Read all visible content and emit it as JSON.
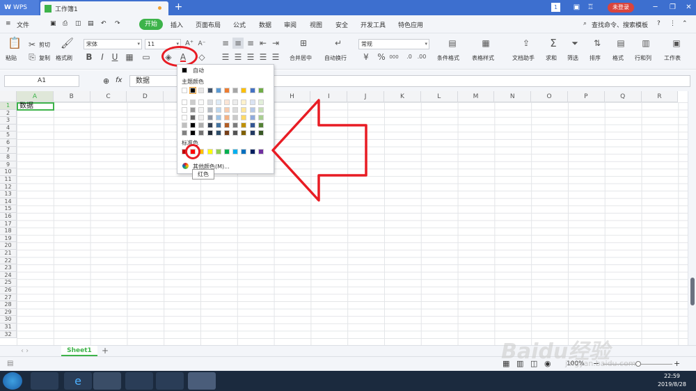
{
  "titlebar": {
    "app": "WPS",
    "doc_tab": "工作簿1",
    "new_tab": "+",
    "page_badge": "1",
    "login": "未登录"
  },
  "menubar": {
    "file": "文件",
    "tabs": [
      "开始",
      "插入",
      "页面布局",
      "公式",
      "数据",
      "审阅",
      "视图",
      "安全",
      "开发工具",
      "特色应用"
    ],
    "search": "查找命令、搜索模板"
  },
  "toolbar": {
    "paste": "粘贴",
    "cut": "剪切",
    "copy": "复制",
    "format_painter": "格式刷",
    "font_name": "宋体",
    "font_size": "11",
    "merge": "合并居中",
    "wrap": "自动换行",
    "number_format": "常规",
    "cond_format": "条件格式",
    "table_style": "表格样式",
    "doc_helper": "文档助手",
    "sum": "求和",
    "filter": "筛选",
    "sort": "排序",
    "format": "格式",
    "rowcol": "行和列",
    "sheet": "工作表",
    "bold": "B",
    "italic": "I",
    "underline": "U",
    "font_color": "A",
    "percent": "%",
    "thousands": "000"
  },
  "formulabar": {
    "cell_ref": "A1",
    "fx": "fx",
    "content": "数据"
  },
  "grid": {
    "columns": [
      "A",
      "B",
      "C",
      "D",
      "E",
      "F",
      "G",
      "H",
      "I",
      "J",
      "K",
      "L",
      "M",
      "N",
      "O",
      "P",
      "Q",
      "R"
    ],
    "rows": [
      "1",
      "2",
      "3",
      "4",
      "5",
      "6",
      "7",
      "8",
      "9",
      "10",
      "11",
      "12",
      "13",
      "14",
      "15",
      "16",
      "17",
      "18",
      "19",
      "20",
      "21",
      "22",
      "23",
      "24",
      "25",
      "26",
      "27",
      "28",
      "29",
      "30",
      "31",
      "32"
    ],
    "a1_value": "数据"
  },
  "palette": {
    "auto_label": "自动",
    "theme_label": "主题颜色",
    "standard_label": "标准色",
    "more_colors": "其他颜色(M)...",
    "tooltip": "红色",
    "theme_top": [
      "#ffffff",
      "#000000",
      "#e7e6e6",
      "#44546a",
      "#5b9bd5",
      "#ed7d31",
      "#a5a5a5",
      "#ffc000",
      "#4472c4",
      "#70ad47"
    ],
    "standard": [
      "#c00000",
      "#ff0000",
      "#ffc000",
      "#ffff00",
      "#92d050",
      "#00b050",
      "#00b0f0",
      "#0070c0",
      "#002060",
      "#7030a0"
    ]
  },
  "sheets": {
    "tab": "Sheet1",
    "add": "+"
  },
  "status": {
    "zoom": "100%",
    "minus": "−",
    "plus": "+"
  },
  "taskbar": {
    "time": "22:59",
    "date": "2019/8/28"
  },
  "watermark": {
    "logo": "Baidu经验",
    "url": "jingyan.baidu.com"
  },
  "colors": {
    "accent_green": "#3db34a",
    "title_blue": "#3d6fcf",
    "annotation_red": "#e81c24"
  }
}
